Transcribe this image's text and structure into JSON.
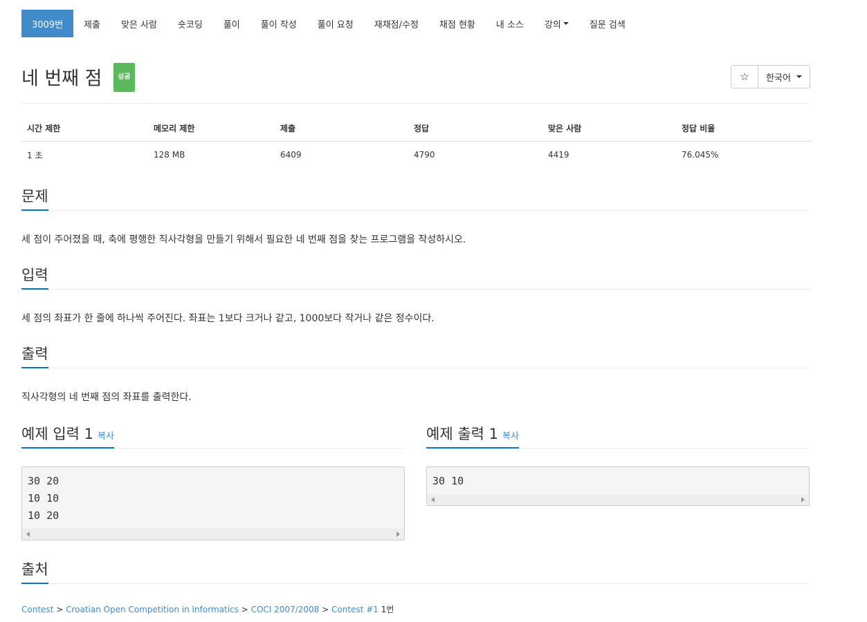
{
  "tabs": [
    {
      "label": "3009번",
      "active": true
    },
    {
      "label": "제출"
    },
    {
      "label": "맞은 사람"
    },
    {
      "label": "숏코딩"
    },
    {
      "label": "풀이"
    },
    {
      "label": "풀이 작성"
    },
    {
      "label": "풀이 요청"
    },
    {
      "label": "재채점/수정"
    },
    {
      "label": "채점 현황"
    },
    {
      "label": "내 소스"
    },
    {
      "label": "강의"
    },
    {
      "label": "질문 검색"
    }
  ],
  "title": "네 번째 점",
  "badge": "성공",
  "star": "☆",
  "language": "한국어",
  "table": {
    "headers": [
      "시간 제한",
      "메모리 제한",
      "제출",
      "정답",
      "맞은 사람",
      "정답 비율"
    ],
    "row": [
      "1 초",
      "128 MB",
      "6409",
      "4790",
      "4419",
      "76.045%"
    ]
  },
  "problem": {
    "heading": "문제",
    "text": "세 점이 주어졌을 때, 축에 평행한 직사각형을 만들기 위해서 필요한 네 번째 점을 찾는 프로그램을 작성하시오."
  },
  "input": {
    "heading": "입력",
    "text": "세 점의 좌표가 한 줄에 하나씩 주어진다. 좌표는 1보다 크거나 같고, 1000보다 작거나 같은 정수이다."
  },
  "output": {
    "heading": "출력",
    "text": "직사각형의 네 번째 점의 좌표를 출력한다."
  },
  "sample_input": {
    "heading": "예제 입력 1",
    "copy": "복사",
    "content": "30 20\n10 10\n10 20"
  },
  "sample_output": {
    "heading": "예제 출력 1",
    "copy": "복사",
    "content": "30 10"
  },
  "source": {
    "heading": "출처",
    "links": [
      "Contest",
      "Croatian Open Competition in Informatics",
      "COCI 2007/2008",
      "Contest #1"
    ],
    "separator": ">",
    "suffix": "1번"
  },
  "colors": {
    "active_tab": "#428bca",
    "badge": "#5cb85c",
    "section_underline": "#0076c0",
    "link": "#428bca"
  }
}
